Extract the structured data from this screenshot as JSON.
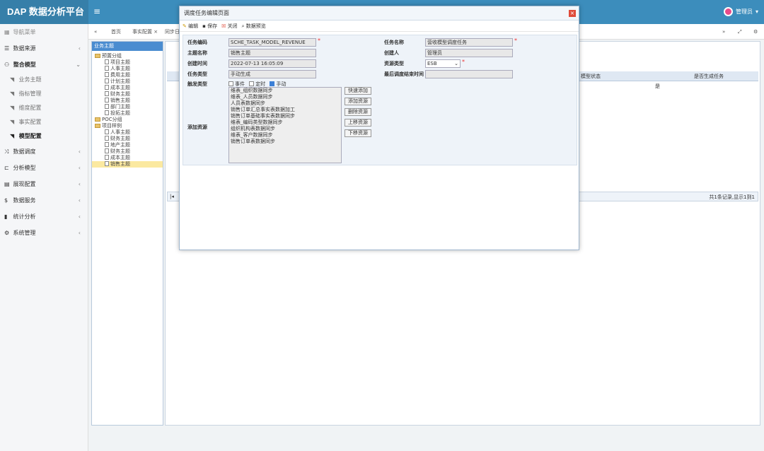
{
  "app": {
    "title": "DAP 数据分析平台",
    "user": "管理员"
  },
  "sidebar": {
    "header": "导航菜单",
    "items": [
      {
        "label": "数据来源"
      },
      {
        "label": "整合模型",
        "subitems": [
          "业务主题",
          "指标管理",
          "维度配置",
          "事实配置",
          "模型配置"
        ]
      },
      {
        "label": "数据调度"
      },
      {
        "label": "分析模型"
      },
      {
        "label": "展现配置"
      },
      {
        "label": "数据服务"
      },
      {
        "label": "统计分析"
      },
      {
        "label": "系统管理"
      }
    ]
  },
  "tabs": [
    "首页",
    "事实配置 ×",
    "同步日"
  ],
  "tree": {
    "header": "业务主题",
    "nodes": [
      {
        "label": "预置分组",
        "type": "folder",
        "level": 0
      },
      {
        "label": "项目主题",
        "type": "file",
        "level": 1
      },
      {
        "label": "人事主题",
        "type": "file",
        "level": 1
      },
      {
        "label": "费用主题",
        "type": "file",
        "level": 1
      },
      {
        "label": "计划主题",
        "type": "file",
        "level": 1
      },
      {
        "label": "成本主题",
        "type": "file",
        "level": 1
      },
      {
        "label": "财务主题",
        "type": "file",
        "level": 1
      },
      {
        "label": "销售主题",
        "type": "file",
        "level": 1
      },
      {
        "label": "部门主题",
        "type": "file",
        "level": 1
      },
      {
        "label": "投拓主题",
        "type": "file",
        "level": 1
      },
      {
        "label": "POC分组",
        "type": "folder",
        "level": 0
      },
      {
        "label": "项目样例",
        "type": "folder",
        "level": 0
      },
      {
        "label": "人事主题",
        "type": "file",
        "level": 1
      },
      {
        "label": "财务主题",
        "type": "file",
        "level": 1
      },
      {
        "label": "地产主题",
        "type": "file",
        "level": 1
      },
      {
        "label": "财务主题",
        "type": "file",
        "level": 1
      },
      {
        "label": "成本主题",
        "type": "file",
        "level": 1
      },
      {
        "label": "销售主题",
        "type": "file",
        "level": 1,
        "selected": true
      }
    ]
  },
  "grid": {
    "columns": [
      "模型状态",
      "是否生成任务"
    ],
    "row": [
      "",
      "是"
    ],
    "pager": "共1条记录,显示1到1"
  },
  "modal": {
    "title": "调度任务编辑页面",
    "toolbar": [
      "编辑",
      "保存",
      "关闭",
      "数据预览"
    ],
    "fields": {
      "task_code": {
        "label": "任务编码",
        "value": "SCHE_TASK_MODEL_REVENUE"
      },
      "task_name": {
        "label": "任务名称",
        "value": "营收模型调度任务"
      },
      "topic_name": {
        "label": "主题名称",
        "value": "销售主题"
      },
      "creator": {
        "label": "创建人",
        "value": "管理员"
      },
      "create_time": {
        "label": "创建时间",
        "value": "2022-07-13 16:05:09"
      },
      "resource_type": {
        "label": "资源类型",
        "value": "ESB"
      },
      "task_type": {
        "label": "任务类型",
        "value": "手动生成"
      },
      "last_end": {
        "label": "最后调度结束时间",
        "value": ""
      },
      "trigger": {
        "label": "触发类型",
        "options": [
          "事件",
          "定时",
          "手动"
        ],
        "checked": "手动"
      },
      "add_resource": {
        "label": "添加资源"
      }
    },
    "resources": [
      "维表_组织数据同步",
      "维表_人员数据同步",
      "人员表数据同步",
      "销售订单汇总事实表数据加工",
      "销售订单基础事实表数据同步",
      "维表_编码类型数据同步",
      "组织机构表数据同步",
      "维表_客户数据同步",
      "销售订单表数据同步"
    ],
    "resource_buttons": [
      "快速添加",
      "添加资源",
      "删除资源",
      "上移资源",
      "下移资源"
    ]
  }
}
